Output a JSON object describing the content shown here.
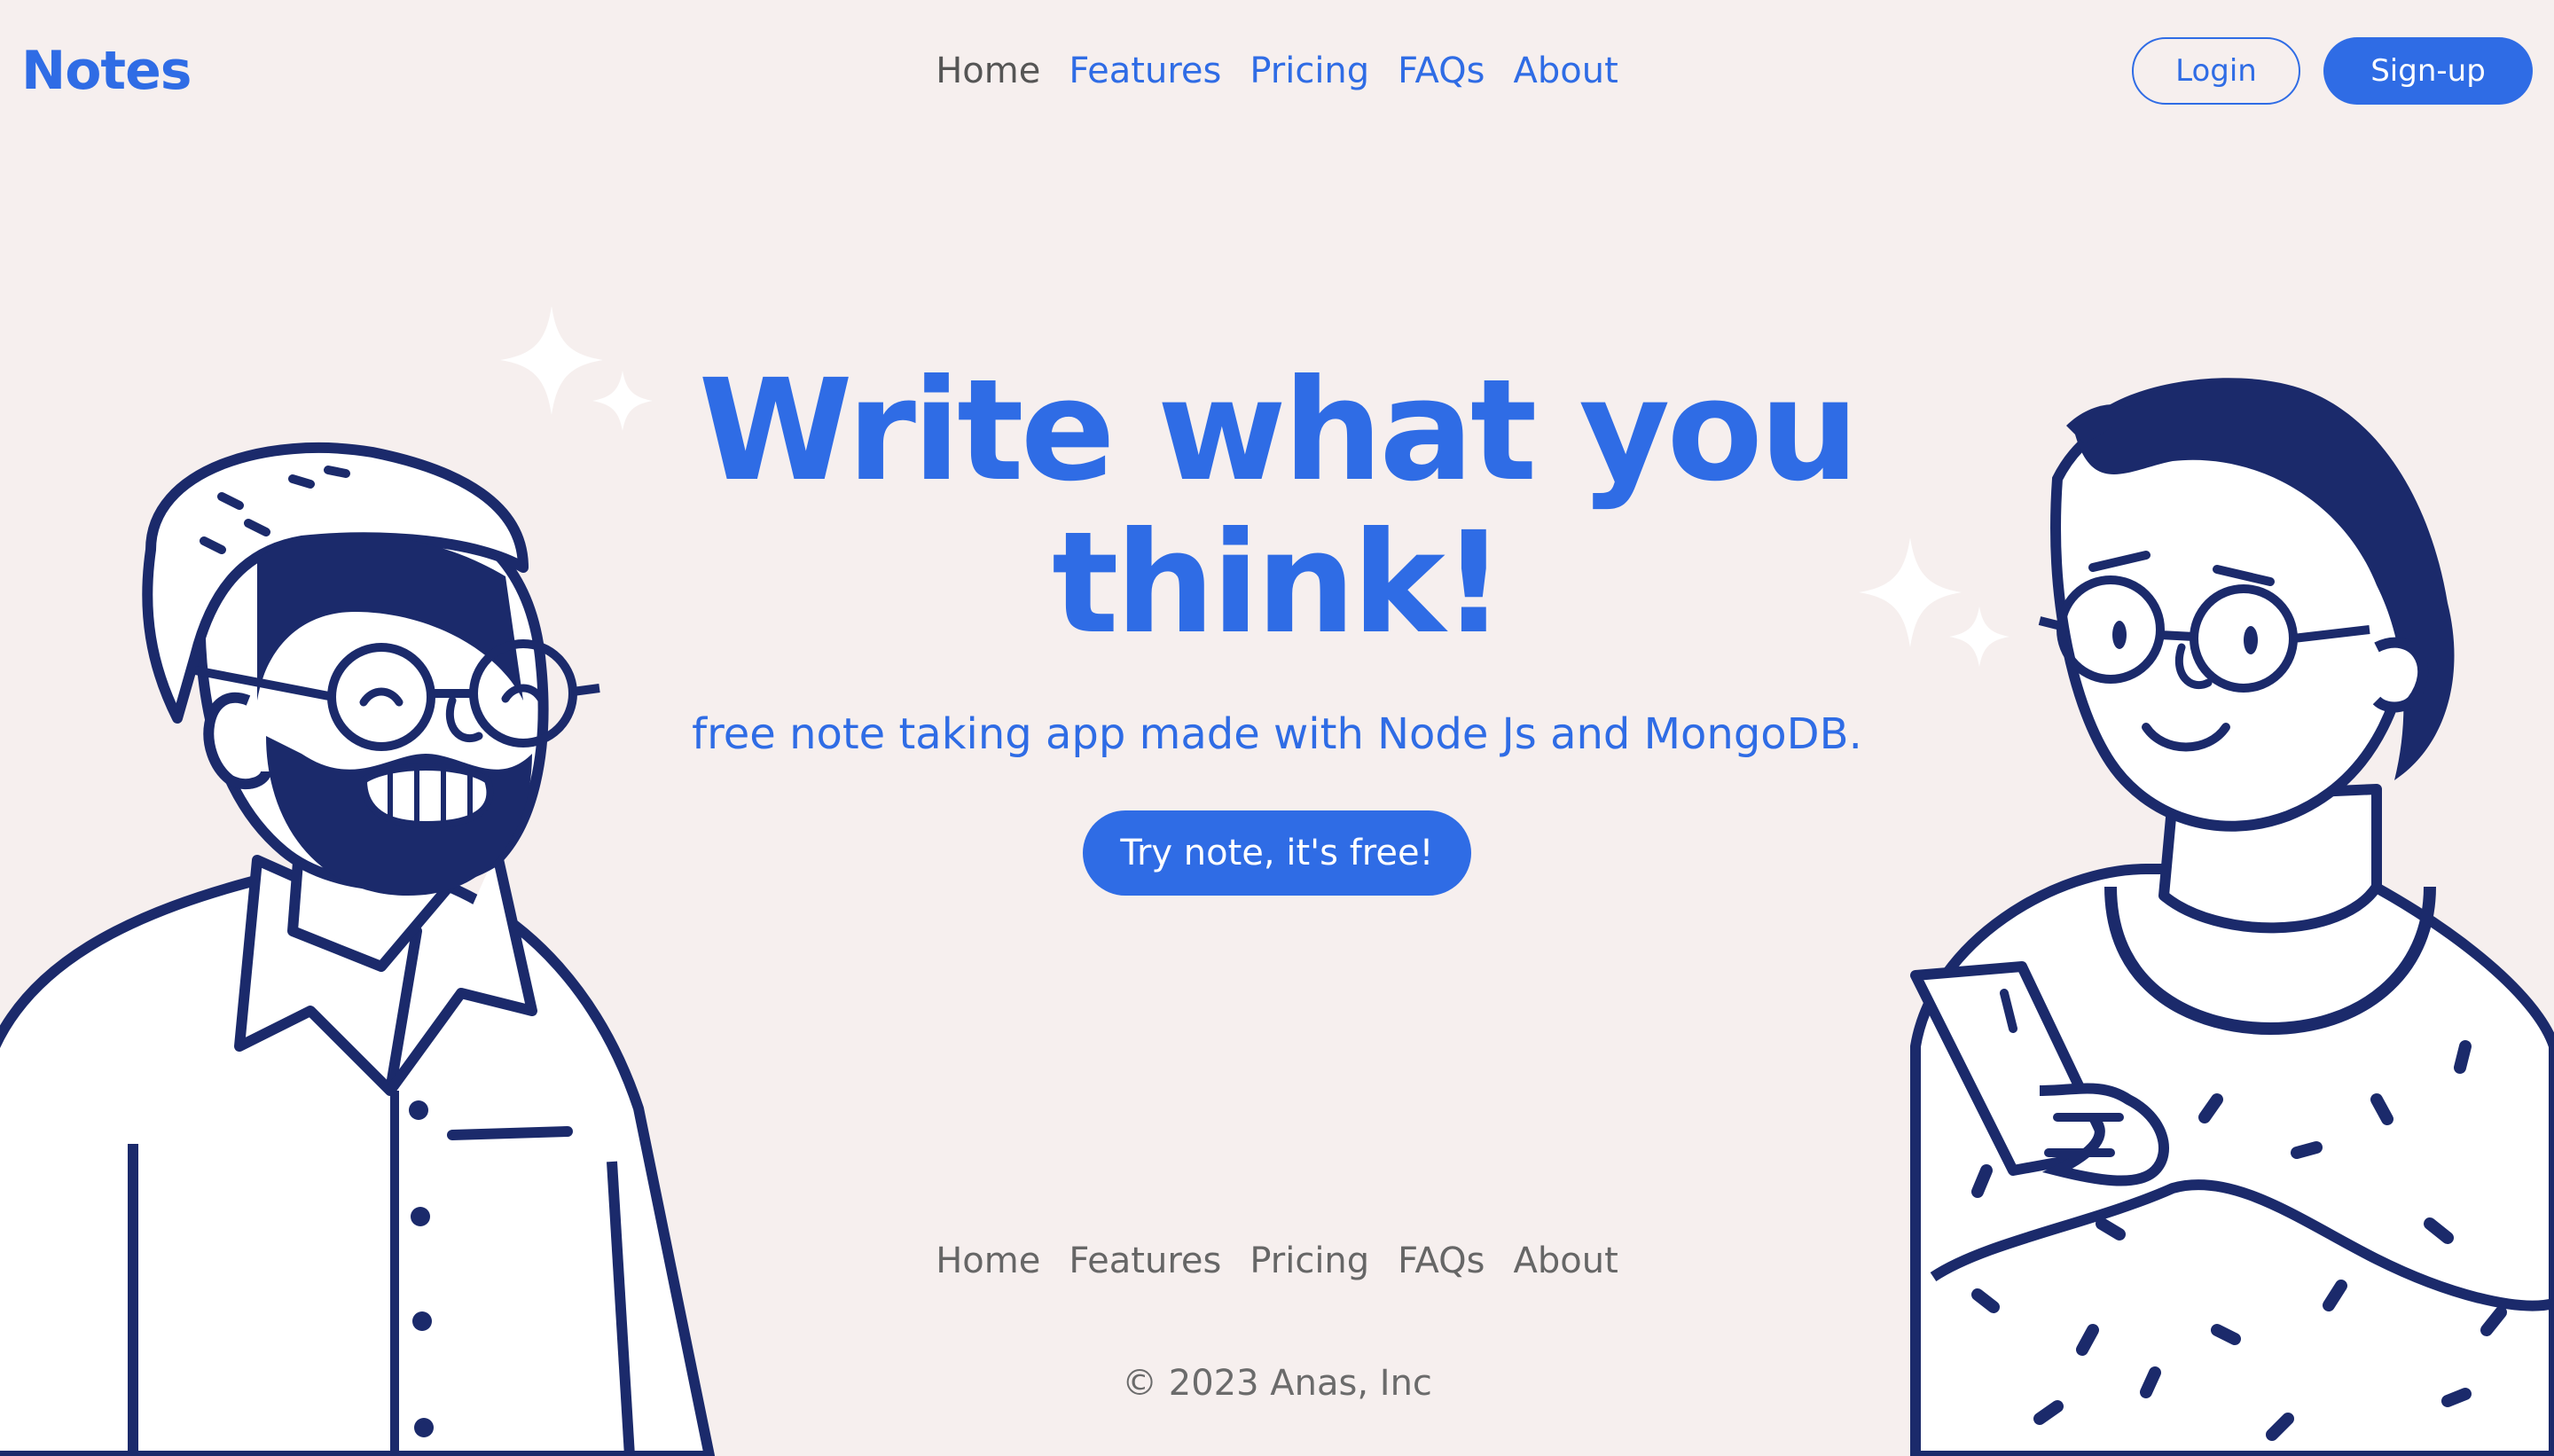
{
  "brand": {
    "logo": "Notes"
  },
  "header": {
    "nav": [
      "Home",
      "Features",
      "Pricing",
      "FAQs",
      "About"
    ],
    "login_label": "Login",
    "signup_label": "Sign-up"
  },
  "hero": {
    "title_line1": "Write what you",
    "title_line2": "think!",
    "subtitle": "free note taking app made with Node Js and MongoDB.",
    "cta_label": "Try note, it's free!"
  },
  "footer": {
    "nav": [
      "Home",
      "Features",
      "Pricing",
      "FAQs",
      "About"
    ],
    "copyright": "© 2023 Anas, Inc"
  },
  "colors": {
    "background": "#f6efee",
    "accent": "#2f6ce5",
    "illustration_navy": "#1b2a6b"
  },
  "icons": [
    "sparkle-icon",
    "man-illustration",
    "woman-illustration"
  ]
}
